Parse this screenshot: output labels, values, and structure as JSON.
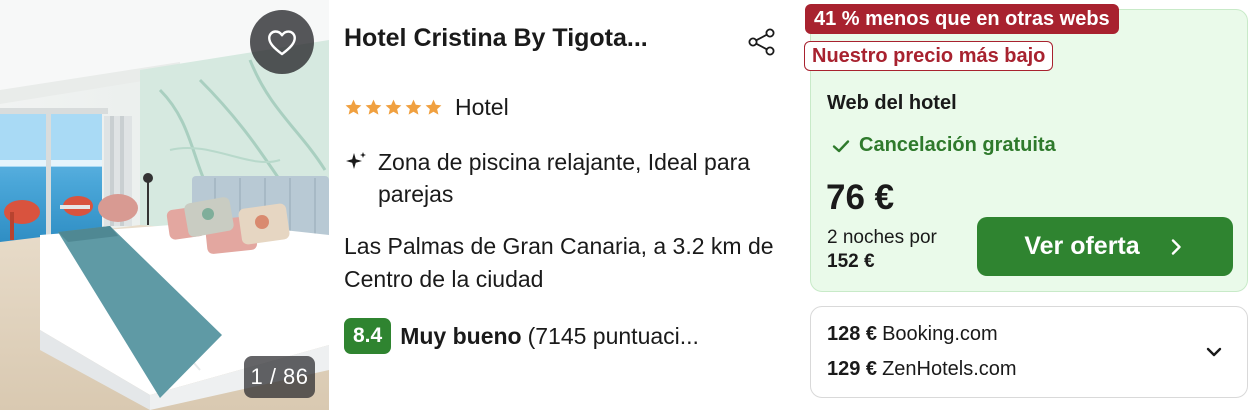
{
  "photo": {
    "counter": "1 / 86",
    "favorite_icon": "heart-outline-icon"
  },
  "hotel": {
    "name": "Hotel Cristina By Tigota...",
    "stars": 5,
    "type": "Hotel",
    "highlight": "Zona de piscina relajante, Ideal para parejas",
    "location": "Las Palmas de Gran Canaria, a 3.2 km de Centro de la ciudad",
    "rating": {
      "score": "8.4",
      "label": "Muy bueno",
      "count": "(7145 puntuaci..."
    }
  },
  "offer": {
    "discount_badge": "41 % menos que en otras webs",
    "lowest_badge": "Nuestro precio más bajo",
    "provider": "Web del hotel",
    "cancellation": "Cancelación gratuita",
    "price": "76 €",
    "nights_label": "2 noches por",
    "total": "152 €",
    "cta_label": "Ver oferta"
  },
  "other_offers": [
    {
      "price": "128 €",
      "site": "Booking.com"
    },
    {
      "price": "129 €",
      "site": "ZenHotels.com"
    }
  ],
  "colors": {
    "accent_green": "#2f8430",
    "badge_red": "#a8222f",
    "offer_bg": "#eafaea",
    "star": "#f0a040"
  }
}
